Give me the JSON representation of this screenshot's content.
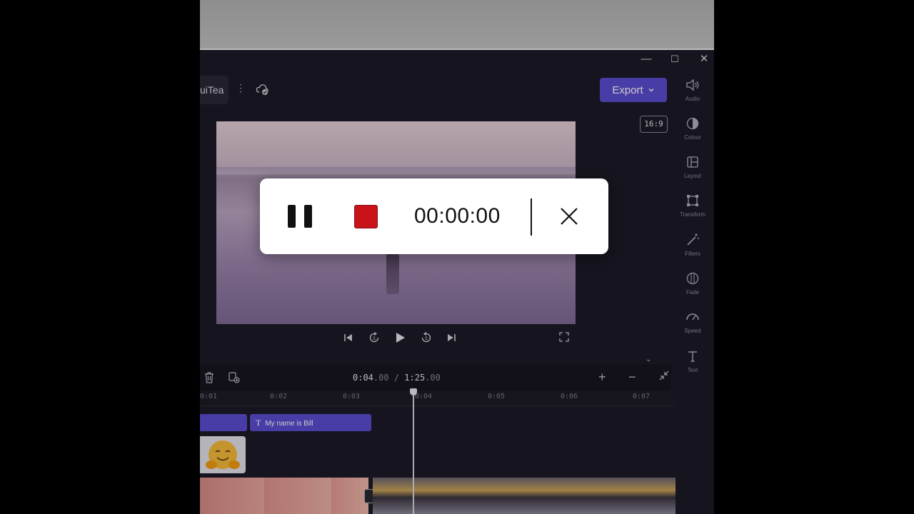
{
  "window": {
    "minimize": "—",
    "maximize": "☐",
    "close": "✕"
  },
  "project": {
    "name": "uiTea",
    "more": "⋮"
  },
  "header": {
    "export_label": "Export",
    "ratio": "16:9"
  },
  "right_panel": [
    {
      "label": "Audio",
      "icon": "speaker-icon"
    },
    {
      "label": "Colour",
      "icon": "contrast-icon"
    },
    {
      "label": "Layout",
      "icon": "layout-icon"
    },
    {
      "label": "Transform",
      "icon": "transform-icon"
    },
    {
      "label": "Filters",
      "icon": "wand-icon"
    },
    {
      "label": "Fade",
      "icon": "fade-icon"
    },
    {
      "label": "Speed",
      "icon": "speedometer-icon"
    },
    {
      "label": "Text",
      "icon": "text-icon"
    }
  ],
  "timeline": {
    "current_main": "0:04",
    "current_frac": ".00",
    "separator": "/",
    "total_main": "1:25",
    "total_frac": ".00",
    "ruler_ticks": [
      "0:01",
      "0:02",
      "0:03",
      "0:04",
      "0:05",
      "0:06",
      "0:07"
    ],
    "text_clip_label": "My name is Bill",
    "zoom_in": "+",
    "zoom_out": "−"
  },
  "recorder": {
    "time": "00:00:00"
  },
  "colors": {
    "accent": "#5b4cd0",
    "stop": "#c8131b"
  }
}
